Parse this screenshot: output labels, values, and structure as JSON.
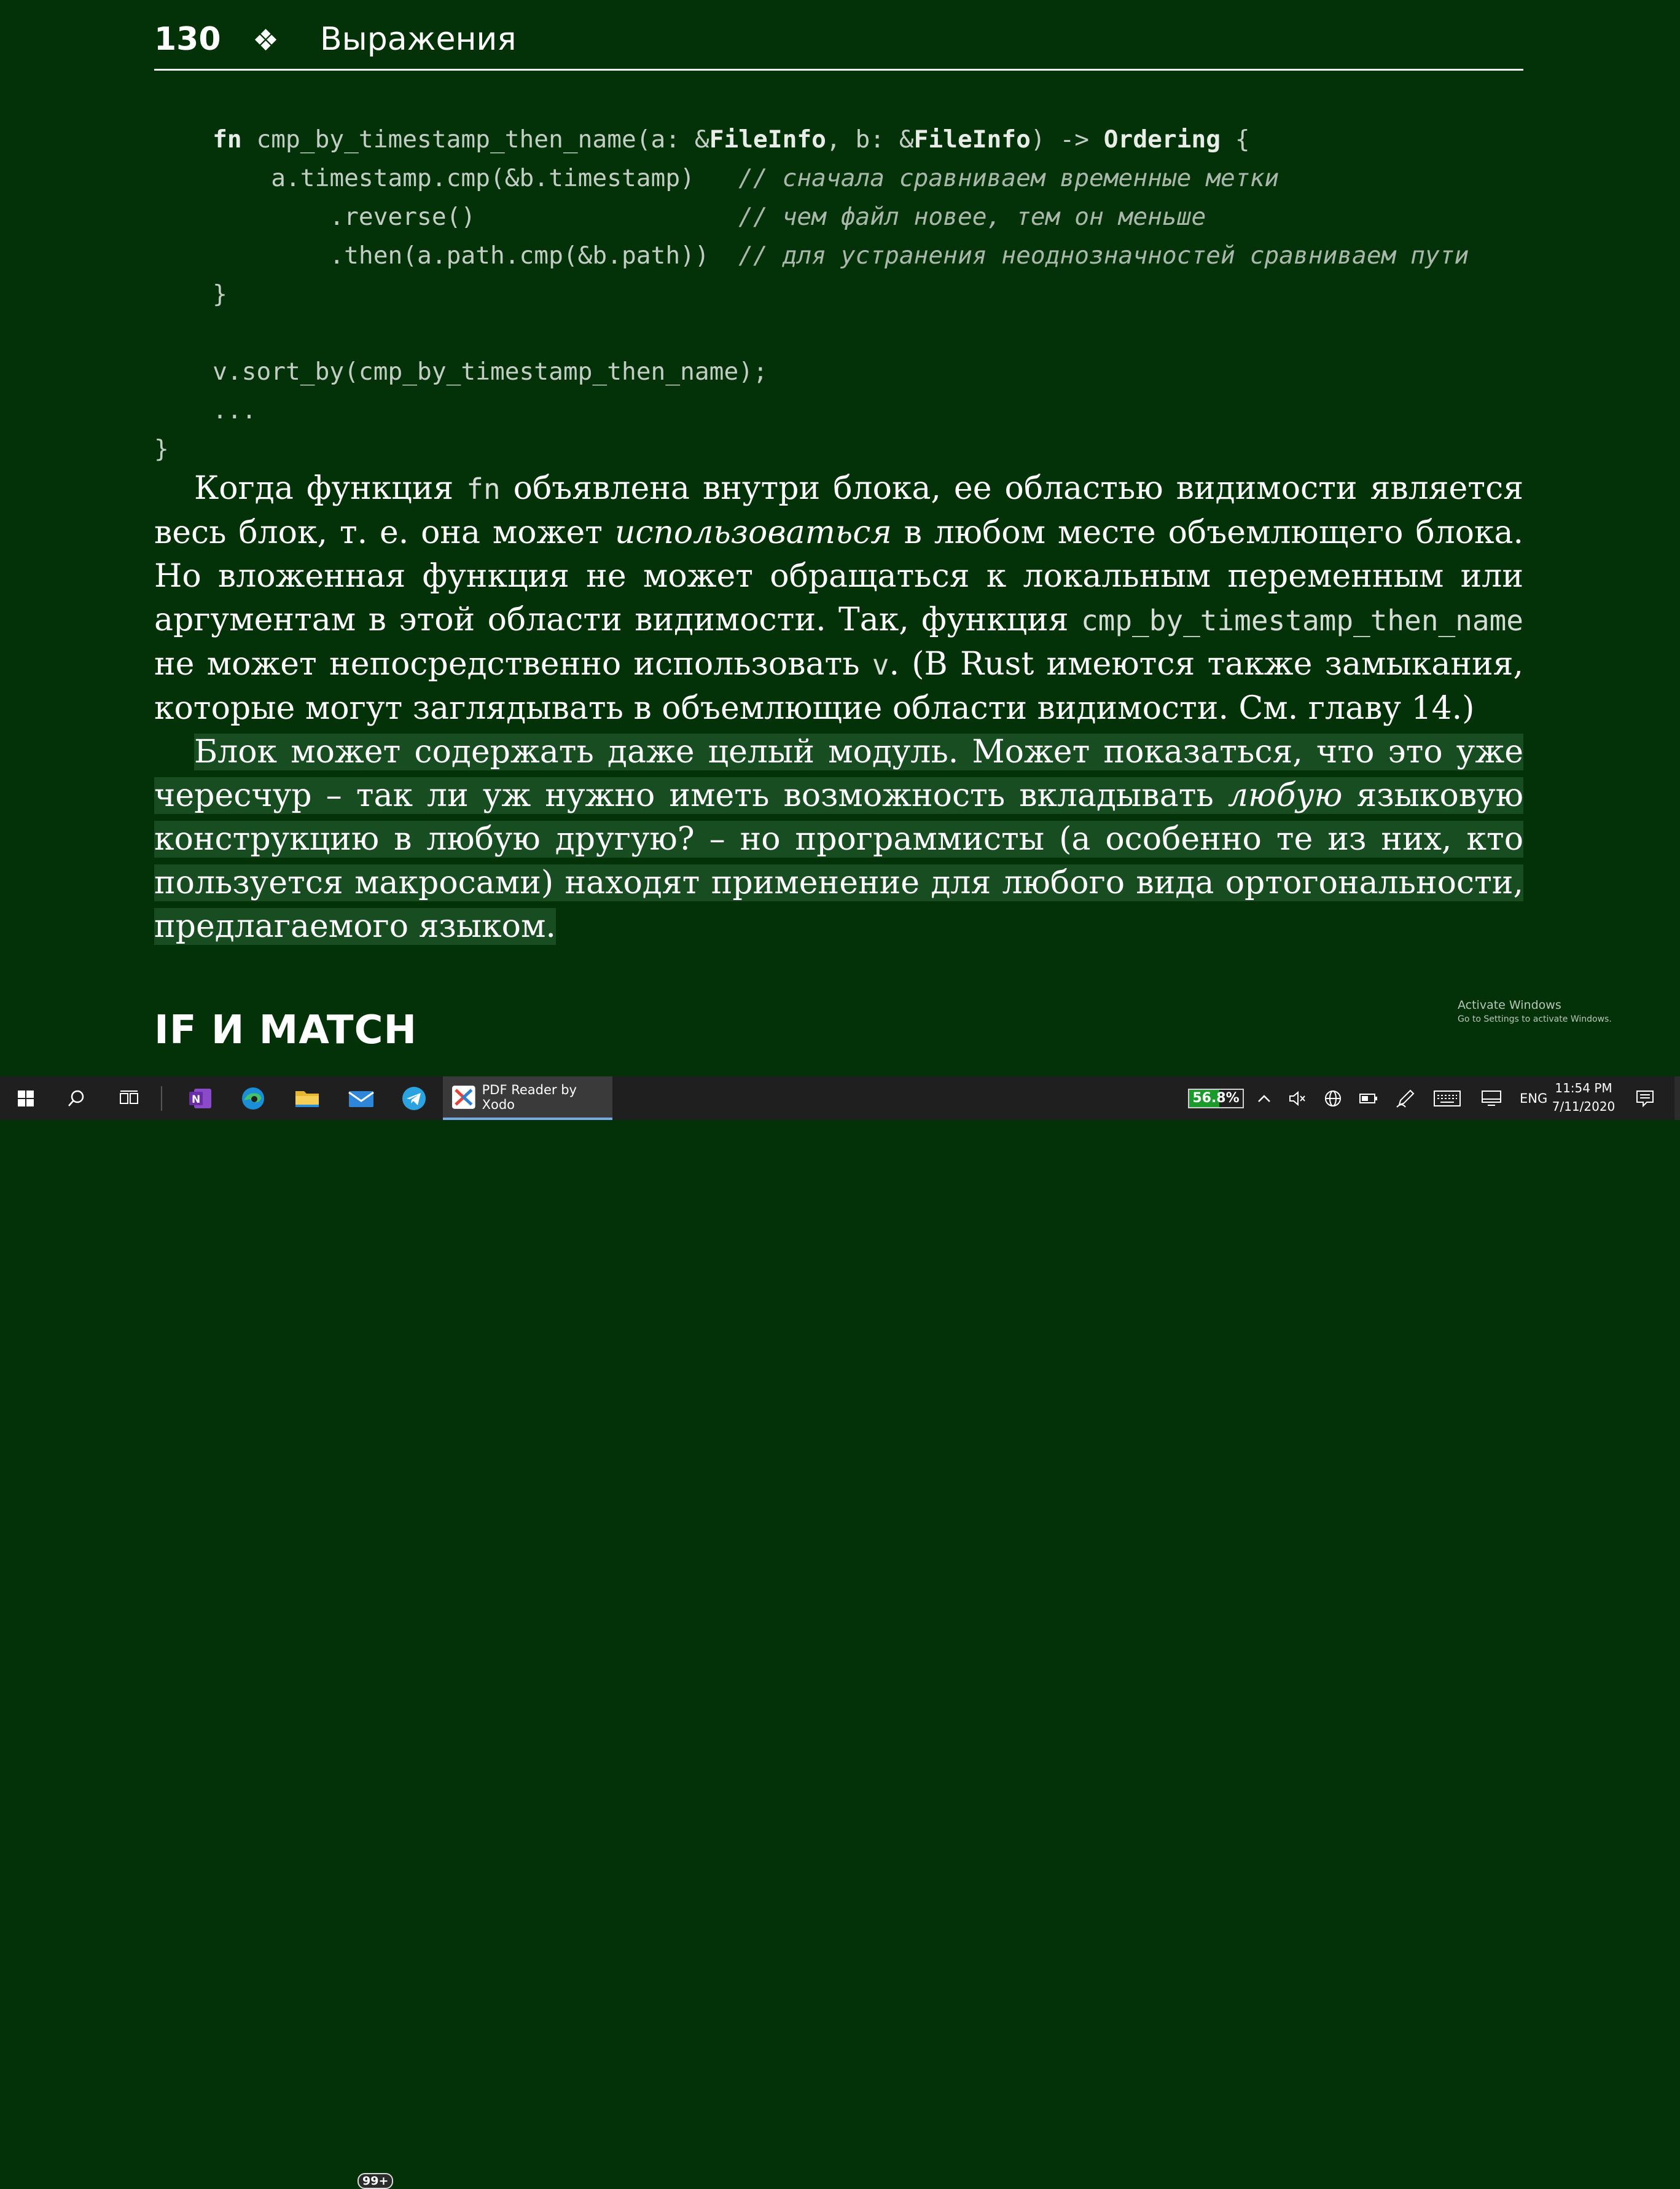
{
  "header": {
    "page_number": "130",
    "ornament": "❖",
    "chapter_title": "Выражения"
  },
  "code": {
    "l1_kw": "fn",
    "l1_a": " cmp_by_timestamp_then_name(a: &",
    "l1_t1": "FileInfo",
    "l1_b": ", b: &",
    "l1_t2": "FileInfo",
    "l1_c": ") -> ",
    "l1_t3": "Ordering",
    "l1_d": " {",
    "l2_code": "    a.timestamp.cmp(&b.timestamp)   ",
    "l2_comment": "// сначала сравниваем временные метки",
    "l3_code": "        .reverse()                  ",
    "l3_comment": "// чем файл новее, тем он меньше",
    "l4_code": "        .then(a.path.cmp(&b.path))  ",
    "l4_comment": "// для устранения неоднозначностей сравниваем пути",
    "l5": "}",
    "l6": "v.sort_by(cmp_by_timestamp_then_name);",
    "l7": "...",
    "l8": "}"
  },
  "paragraph1": {
    "t1": "Когда функция ",
    "code1": "fn",
    "t2": " объявлена внутри блока, ее областью видимости является весь блок, т. е. она может ",
    "em1": "использоваться",
    "t3": " в любом месте объемлющего блока. Но вложенная функция не может обращаться к локальным переменным или аргу­ментам в этой области видимости. Так, функция ",
    "code2": "cmp_by_timestamp_then_name",
    "t4": " не мо­жет непосредственно использовать ",
    "code3": "v",
    "t5": ". (В Rust имеются также замыкания, которые могут заглядывать в объемлющие области видимости. См. главу 14.)"
  },
  "paragraph2": {
    "t1": "Блок может содержать даже целый модуль. Может показаться, что это уже черес­чур – так ли уж нужно иметь возможность вкладывать ",
    "em1": "любую",
    "t2": " языковую конструк­цию в любую другую? – но программисты (а особенно те из них, кто пользуется макросами) находят применение для любого вида ортогональности, предлагае­мого языком."
  },
  "section_heading": "IF И MATCH",
  "watermark": {
    "line1": "Activate Windows",
    "line2": "Go to Settings to activate Windows."
  },
  "taskbar": {
    "mail_badge": "99+",
    "active_app_label": "PDF Reader by Xodo",
    "battery_percent": "56.8%",
    "battery_level": 0.568,
    "language": "ENG",
    "time": "11:54 PM",
    "date": "7/11/2020",
    "accent": "#7aa7e6",
    "battery_color": "#1a9b2c"
  },
  "colors": {
    "page_background": "#043208",
    "highlight": "#184d22",
    "taskbar": "#1f1f1f"
  }
}
